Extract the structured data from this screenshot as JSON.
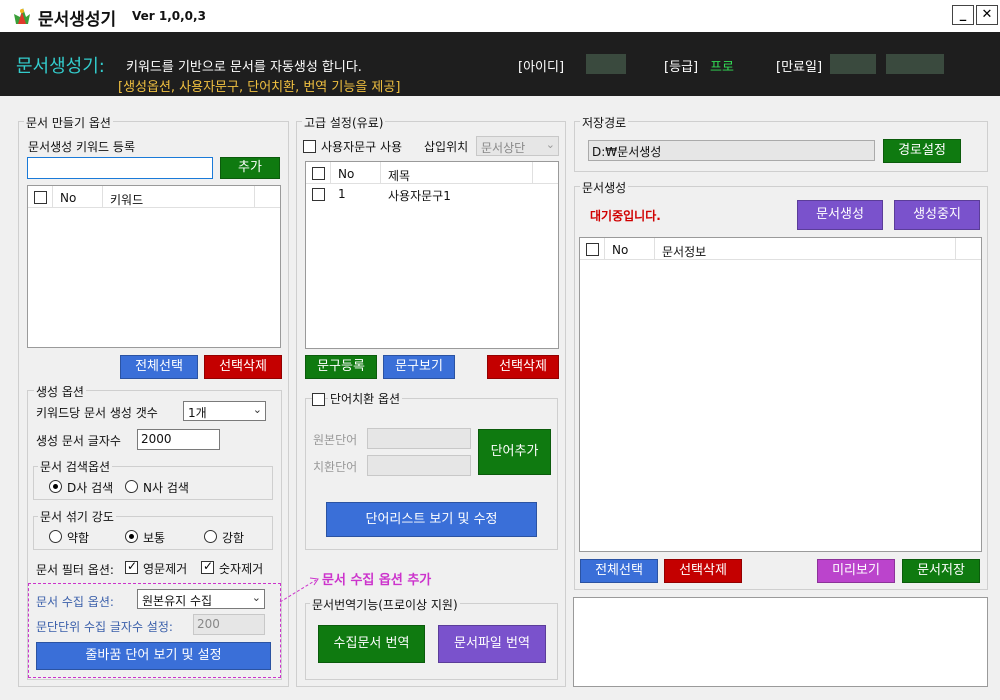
{
  "window": {
    "title": "문서생성기",
    "version": "Ver 1,0,0,3",
    "minimize": "_",
    "close": "✕"
  },
  "header": {
    "brand": "문서생성기:",
    "desc1": "키워드를 기반으로 문서를 자동생성 합니다.",
    "desc2": "[생성옵션, 사용자문구, 단어치환, 번역 기능을 제공]",
    "id_label": "[아이디]",
    "grade_label": "[등급]",
    "grade_value": "프로",
    "expiry_label": "[만료일]"
  },
  "left": {
    "title": "문서 만들기 옵션",
    "keyword_label": "문서생성 키워드 등록",
    "keyword_value": "",
    "add_button": "추가",
    "list_headers": {
      "no": "No",
      "keyword": "키워드"
    },
    "select_all_button": "전체선택",
    "delete_selected_button": "선택삭제",
    "gen_options": {
      "title": "생성 옵션",
      "count_label": "키워드당 문서 생성 갯수",
      "count_value": "1개",
      "length_label": "생성 문서 글자수",
      "length_value": "2000",
      "search": {
        "title": "문서 검색옵션",
        "opt1": "D사 검색",
        "opt2": "N사 검색"
      },
      "shuffle": {
        "title": "문서 섞기 강도",
        "opt1": "약함",
        "opt2": "보통",
        "opt3": "강함"
      },
      "filter_label": "문서 필터 옵션:",
      "filter_en": "영문제거",
      "filter_num": "숫자제거",
      "collect_label": "문서 수집 옵션:",
      "collect_value": "원본유지 수집",
      "para_label": "문단단위 수집 글자수 설정:",
      "para_value": "200",
      "linebreak_button": "줄바꿈 단어 보기 및 설정"
    }
  },
  "annotation": "문서 수집 옵션 추가",
  "middle": {
    "title": "고급 설정(유료)",
    "use_phrase": "사용자문구 사용",
    "insert_pos_label": "삽입위치",
    "insert_pos_value": "문서상단",
    "list_headers": {
      "no": "No",
      "title": "제목"
    },
    "rows": [
      {
        "no": "1",
        "title": "사용자문구1"
      }
    ],
    "register_button": "문구등록",
    "view_button": "문구보기",
    "delete_button": "선택삭제",
    "replace": {
      "title": "단어치환 옵션",
      "source_label": "원본단어",
      "target_label": "치환단어",
      "add_button": "단어추가",
      "list_button": "단어리스트 보기 및 수정"
    },
    "translate": {
      "title": "문서번역기능(프로이상 지원)",
      "collected_button": "수집문서 번역",
      "file_button": "문서파일 번역"
    }
  },
  "right": {
    "save_title": "저장경로",
    "save_path": "D:₩문서생성",
    "path_button": "경로설정",
    "gen_title": "문서생성",
    "status": "대기중입니다.",
    "generate_button": "문서생성",
    "stop_button": "생성중지",
    "list_headers": {
      "no": "No",
      "info": "문서정보"
    },
    "select_all_button": "전체선택",
    "delete_selected_button": "선택삭제",
    "preview_button": "미리보기",
    "save_button": "문서저장"
  }
}
